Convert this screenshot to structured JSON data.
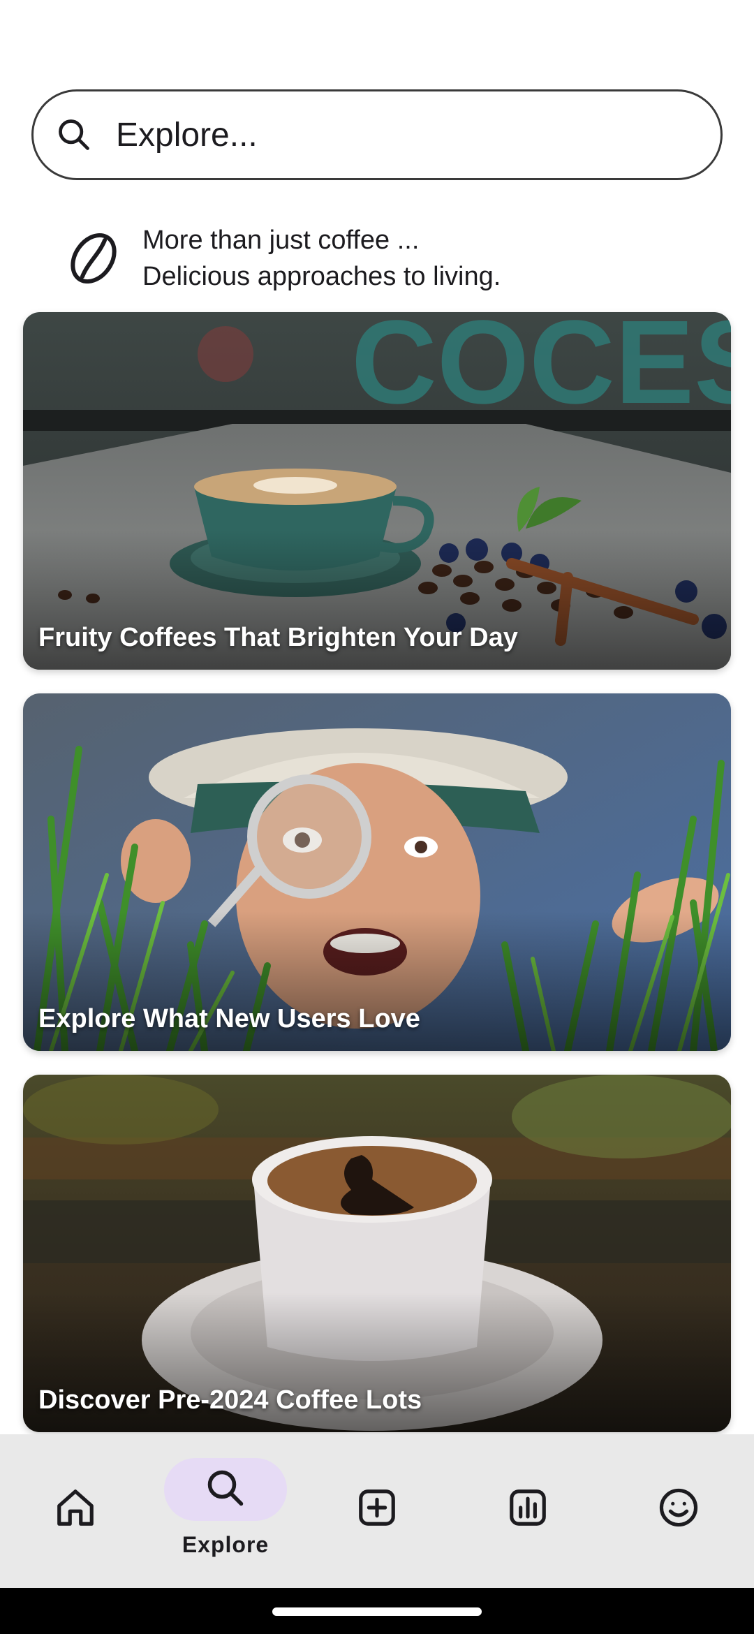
{
  "search": {
    "placeholder": "Explore..."
  },
  "tagline": {
    "line1": "More than just coffee ...",
    "line2": "Delicious approaches to living.",
    "logo_icon": "coffee-bean-icon"
  },
  "cards": [
    {
      "title": "Fruity Coffees That Brighten Your Day",
      "image": "latte-cup-with-beans-photo"
    },
    {
      "title": "Explore What New Users Love",
      "image": "explorer-with-magnifying-glass-photo"
    },
    {
      "title": "Discover Pre-2024 Coffee Lots",
      "image": "espresso-cup-on-saucer-photo"
    }
  ],
  "nav": {
    "items": [
      {
        "name": "home",
        "icon": "home-icon",
        "label": ""
      },
      {
        "name": "explore",
        "icon": "search-icon",
        "label": "Explore",
        "active": true
      },
      {
        "name": "add",
        "icon": "add-box-icon",
        "label": ""
      },
      {
        "name": "stats",
        "icon": "chart-icon",
        "label": ""
      },
      {
        "name": "profile",
        "icon": "smiley-icon",
        "label": ""
      }
    ]
  },
  "colors": {
    "nav_background": "#e9e9e9",
    "active_pill": "#e6dbf5",
    "text": "#1c1b1f"
  }
}
